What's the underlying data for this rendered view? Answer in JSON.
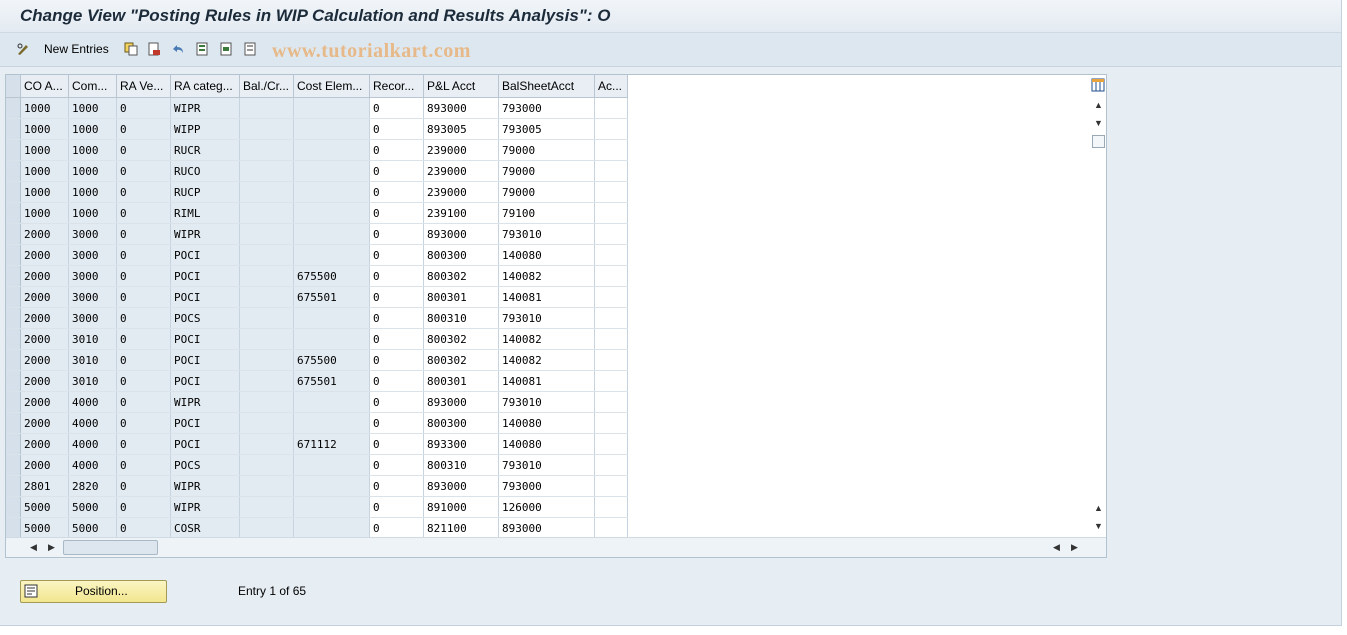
{
  "window": {
    "title": "Change View \"Posting Rules in WIP Calculation and Results Analysis\": O"
  },
  "toolbar": {
    "new_entries_label": "New Entries"
  },
  "watermark": "www.tutorialkart.com",
  "table": {
    "columns": [
      "CO A...",
      "Com...",
      "RA Ve...",
      "RA categ...",
      "Bal./Cr...",
      "Cost Elem...",
      "Recor...",
      "P&L Acct",
      "BalSheetAcct",
      "Ac..."
    ],
    "rows": [
      [
        "1000",
        "1000",
        "0",
        "WIPR",
        "",
        "",
        "0",
        "893000",
        "793000",
        ""
      ],
      [
        "1000",
        "1000",
        "0",
        "WIPP",
        "",
        "",
        "0",
        "893005",
        "793005",
        ""
      ],
      [
        "1000",
        "1000",
        "0",
        "RUCR",
        "",
        "",
        "0",
        "239000",
        "79000",
        ""
      ],
      [
        "1000",
        "1000",
        "0",
        "RUCO",
        "",
        "",
        "0",
        "239000",
        "79000",
        ""
      ],
      [
        "1000",
        "1000",
        "0",
        "RUCP",
        "",
        "",
        "0",
        "239000",
        "79000",
        ""
      ],
      [
        "1000",
        "1000",
        "0",
        "RIML",
        "",
        "",
        "0",
        "239100",
        "79100",
        ""
      ],
      [
        "2000",
        "3000",
        "0",
        "WIPR",
        "",
        "",
        "0",
        "893000",
        "793010",
        ""
      ],
      [
        "2000",
        "3000",
        "0",
        "POCI",
        "",
        "",
        "0",
        "800300",
        "140080",
        ""
      ],
      [
        "2000",
        "3000",
        "0",
        "POCI",
        "",
        "675500",
        "0",
        "800302",
        "140082",
        ""
      ],
      [
        "2000",
        "3000",
        "0",
        "POCI",
        "",
        "675501",
        "0",
        "800301",
        "140081",
        ""
      ],
      [
        "2000",
        "3000",
        "0",
        "POCS",
        "",
        "",
        "0",
        "800310",
        "793010",
        ""
      ],
      [
        "2000",
        "3010",
        "0",
        "POCI",
        "",
        "",
        "0",
        "800302",
        "140082",
        ""
      ],
      [
        "2000",
        "3010",
        "0",
        "POCI",
        "",
        "675500",
        "0",
        "800302",
        "140082",
        ""
      ],
      [
        "2000",
        "3010",
        "0",
        "POCI",
        "",
        "675501",
        "0",
        "800301",
        "140081",
        ""
      ],
      [
        "2000",
        "4000",
        "0",
        "WIPR",
        "",
        "",
        "0",
        "893000",
        "793010",
        ""
      ],
      [
        "2000",
        "4000",
        "0",
        "POCI",
        "",
        "",
        "0",
        "800300",
        "140080",
        ""
      ],
      [
        "2000",
        "4000",
        "0",
        "POCI",
        "",
        "671112",
        "0",
        "893300",
        "140080",
        ""
      ],
      [
        "2000",
        "4000",
        "0",
        "POCS",
        "",
        "",
        "0",
        "800310",
        "793010",
        ""
      ],
      [
        "2801",
        "2820",
        "0",
        "WIPR",
        "",
        "",
        "0",
        "893000",
        "793000",
        ""
      ],
      [
        "5000",
        "5000",
        "0",
        "WIPR",
        "",
        "",
        "0",
        "891000",
        "126000",
        ""
      ],
      [
        "5000",
        "5000",
        "0",
        "COSR",
        "",
        "",
        "0",
        "821100",
        "893000",
        ""
      ]
    ]
  },
  "footer": {
    "position_button": "Position...",
    "entry_text": "Entry 1 of 65"
  },
  "colors": {
    "key_cell": "#e3ebf2",
    "button_yellow": "#f2e68e",
    "watermark": "#e7b988"
  }
}
